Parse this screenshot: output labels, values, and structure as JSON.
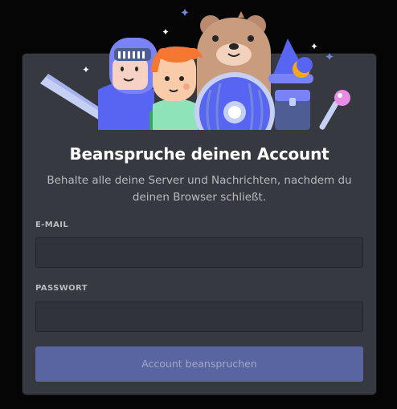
{
  "dialog": {
    "title": "Beanspruche deinen Account",
    "subtitle": "Behalte alle deine Server und Nachrichten, nachdem du deinen Browser schließt."
  },
  "form": {
    "email_label": "E-MAIL",
    "email_value": "",
    "password_label": "PASSWORT",
    "password_value": "",
    "submit_label": "Account beanspruchen"
  },
  "colors": {
    "backdrop": "#060607",
    "modal_background": "#36393f",
    "input_background": "#303339",
    "button_disabled": "#5865a0",
    "title_text": "#ffffff",
    "muted_text": "#b9bbbe"
  },
  "illustration": {
    "icons": [
      "knight-icon",
      "sword-icon",
      "red-haired-character-icon",
      "bear-icon",
      "round-shield-icon",
      "wizard-hat-icon",
      "crescent-moon-icon",
      "treasure-chest-icon",
      "magic-wand-icon",
      "sparkle-icon"
    ]
  }
}
